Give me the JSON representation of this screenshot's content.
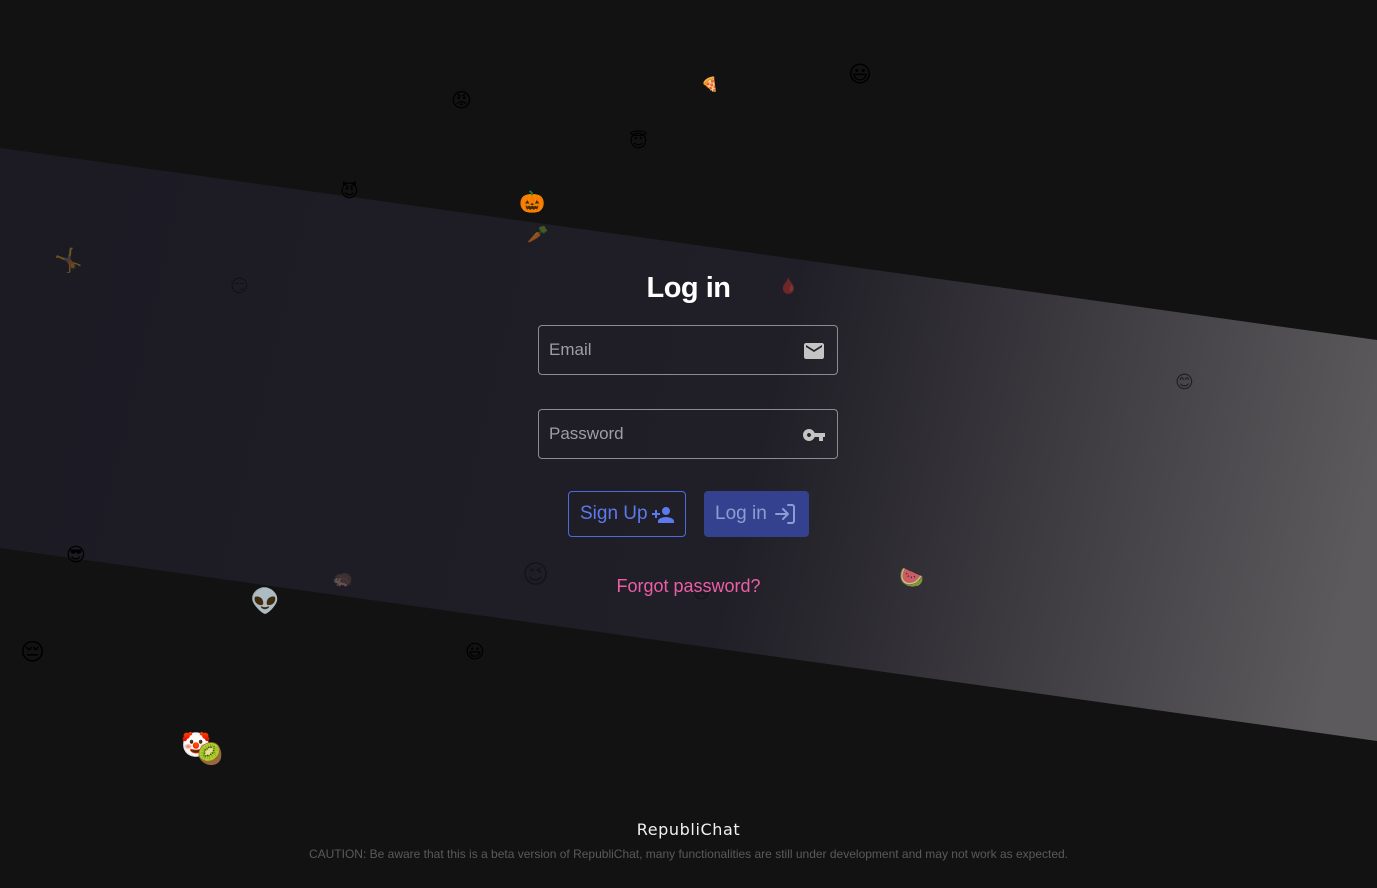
{
  "login": {
    "title": "Log in",
    "email_placeholder": "Email",
    "password_placeholder": "Password",
    "signup_label": "Sign Up",
    "login_label": "Log in",
    "forgot_label": "Forgot password?"
  },
  "footer": {
    "brand": "RepubliChat",
    "caution": "CAUTION: Be aware that this is a beta version of RepubliChat, many functionalities are still under development and may not work as expected."
  },
  "colors": {
    "background": "#121212",
    "band": "#1c1a23",
    "band_highlight": "#5c5a5c",
    "primary": "#5c79ee",
    "primary_filled": "#33418f",
    "link": "#ec5fa8"
  },
  "icons": {
    "email_field": "mail-icon",
    "password_field": "key-icon",
    "signup_button": "person-add-icon",
    "login_button": "login-arrow-icon"
  },
  "background_emojis": [
    "😡",
    "🍕",
    "😃",
    "😇",
    "😈",
    "🎃",
    "🥕",
    "🤸",
    "😏",
    "🩸",
    "😊",
    "😎",
    "👽",
    "🦔",
    "😉",
    "😣",
    "🍉",
    "😔",
    "😃",
    "🤡",
    "🥝"
  ]
}
